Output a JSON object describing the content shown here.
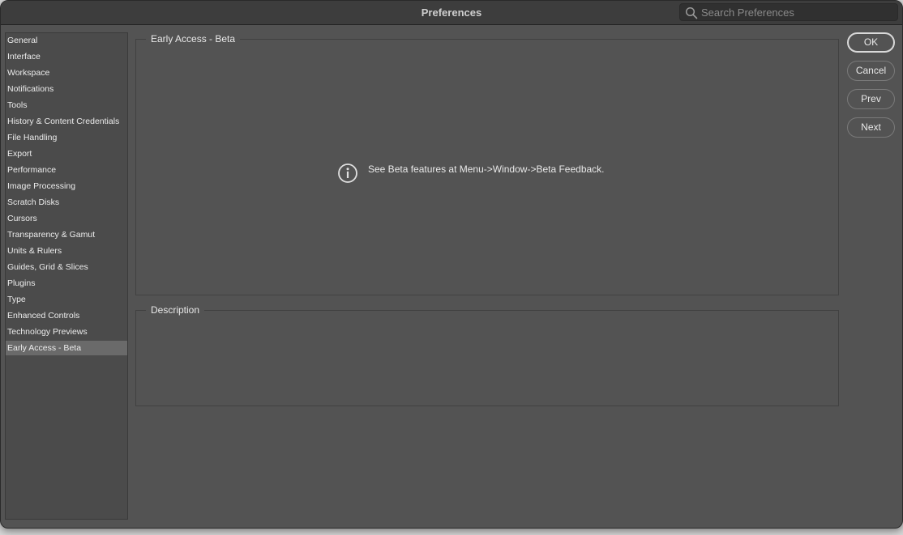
{
  "window": {
    "title": "Preferences"
  },
  "search": {
    "placeholder": "Search Preferences",
    "value": ""
  },
  "sidebar": {
    "items": [
      {
        "label": "General"
      },
      {
        "label": "Interface"
      },
      {
        "label": "Workspace"
      },
      {
        "label": "Notifications"
      },
      {
        "label": "Tools"
      },
      {
        "label": "History & Content Credentials"
      },
      {
        "label": "File Handling"
      },
      {
        "label": "Export"
      },
      {
        "label": "Performance"
      },
      {
        "label": "Image Processing"
      },
      {
        "label": "Scratch Disks"
      },
      {
        "label": "Cursors"
      },
      {
        "label": "Transparency & Gamut"
      },
      {
        "label": "Units & Rulers"
      },
      {
        "label": "Guides, Grid & Slices"
      },
      {
        "label": "Plugins"
      },
      {
        "label": "Type"
      },
      {
        "label": "Enhanced Controls"
      },
      {
        "label": "Technology Previews"
      },
      {
        "label": "Early Access - Beta",
        "selected": true
      }
    ]
  },
  "main": {
    "section_title": "Early Access - Beta",
    "info_icon": "info-circle-icon",
    "info_message": "See Beta features at Menu->Window->Beta Feedback.",
    "description_title": "Description",
    "description_text": ""
  },
  "buttons": {
    "ok": "OK",
    "cancel": "Cancel",
    "prev": "Prev",
    "next": "Next"
  },
  "colors": {
    "panel_bg": "#535353",
    "titlebar_bg": "#3d3d3d",
    "selected_item_bg": "#6a6a6a",
    "text": "#e8e8e8"
  }
}
